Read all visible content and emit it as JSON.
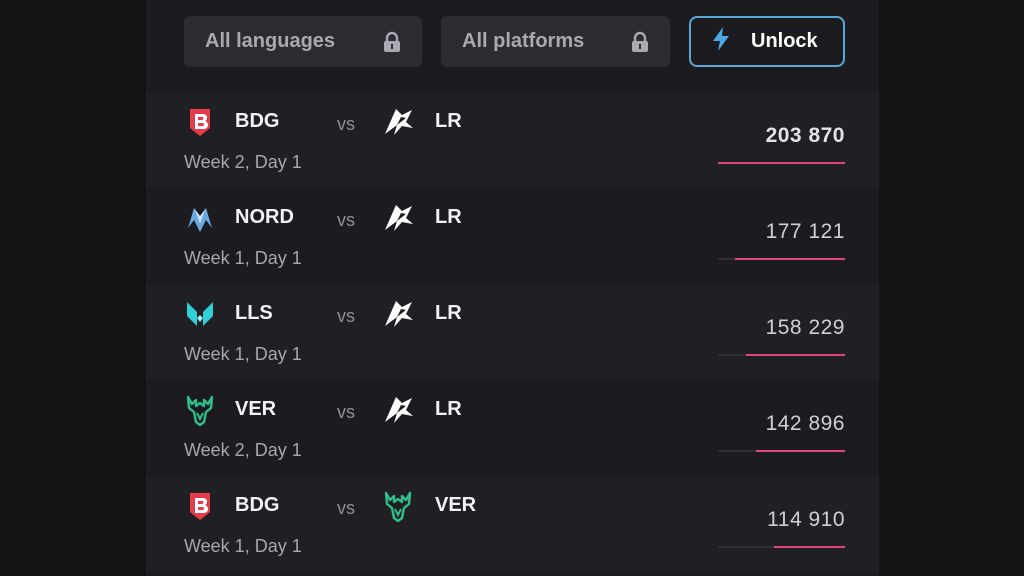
{
  "filters": {
    "language_label": "All languages",
    "platform_label": "All platforms",
    "unlock_label": "Unlock"
  },
  "colors": {
    "accent_pink": "#e0457b",
    "unlock_border": "#5aa8d8",
    "bdg_red": "#e53b4a",
    "nord_blue": "#6aa8e0",
    "lls_cyan": "#2fd0d6",
    "ver_green": "#2fbf8a"
  },
  "matches": [
    {
      "home": "BDG",
      "home_icon": "bdg-logo-icon",
      "vs": "vs",
      "away": "LR",
      "away_icon": "lr-logo-icon",
      "date": "Week 2, Day 1",
      "viewers": "203 870",
      "share": 1.0
    },
    {
      "home": "NORD",
      "home_icon": "nord-logo-icon",
      "vs": "vs",
      "away": "LR",
      "away_icon": "lr-logo-icon",
      "date": "Week 1, Day 1",
      "viewers": "177 121",
      "share": 0.87
    },
    {
      "home": "LLS",
      "home_icon": "lls-logo-icon",
      "vs": "vs",
      "away": "LR",
      "away_icon": "lr-logo-icon",
      "date": "Week 1, Day 1",
      "viewers": "158 229",
      "share": 0.78
    },
    {
      "home": "VER",
      "home_icon": "ver-logo-icon",
      "vs": "vs",
      "away": "LR",
      "away_icon": "lr-logo-icon",
      "date": "Week 2, Day 1",
      "viewers": "142 896",
      "share": 0.7
    },
    {
      "home": "BDG",
      "home_icon": "bdg-logo-icon",
      "vs": "vs",
      "away": "VER",
      "away_icon": "ver-logo-icon",
      "date": "Week 1, Day 1",
      "viewers": "114 910",
      "share": 0.56
    }
  ]
}
